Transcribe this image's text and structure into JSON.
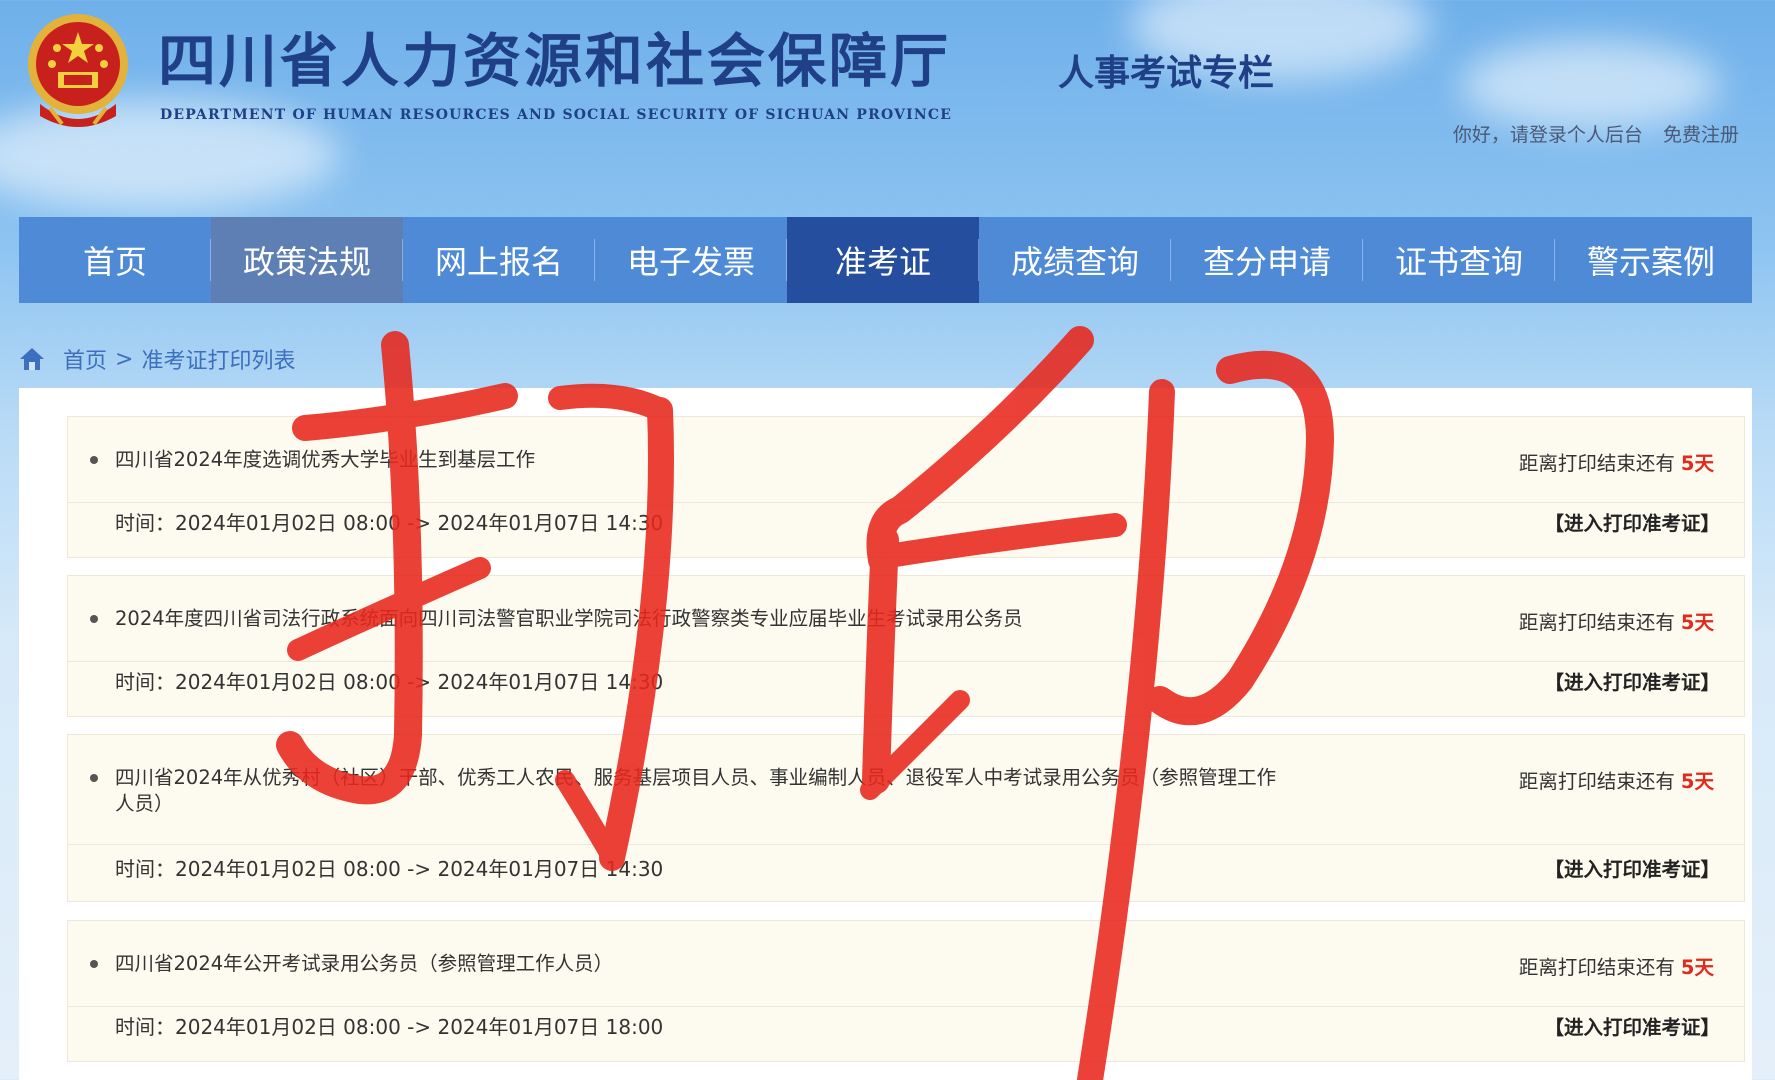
{
  "header": {
    "title": "四川省人力资源和社会保障厅",
    "subtitle": "DEPARTMENT OF HUMAN RESOURCES AND SOCIAL SECURITY OF SICHUAN PROVINCE",
    "column_title": "人事考试专栏",
    "login_text": "你好，请登录个人后台",
    "register_text": "免费注册"
  },
  "nav": {
    "items": [
      {
        "label": "首页"
      },
      {
        "label": "政策法规"
      },
      {
        "label": "网上报名"
      },
      {
        "label": "电子发票"
      },
      {
        "label": "准考证"
      },
      {
        "label": "成绩查询"
      },
      {
        "label": "查分申请"
      },
      {
        "label": "证书查询"
      },
      {
        "label": "警示案例"
      }
    ],
    "active_index": 4
  },
  "breadcrumb": {
    "home": "首页",
    "separator": ">",
    "current": "准考证打印列表"
  },
  "list": [
    {
      "title": "四川省2024年度选调优秀大学毕业生到基层工作",
      "countdown_label": "距离打印结束还有",
      "countdown_days": "5天",
      "time": "时间：2024年01月02日 08:00 -> 2024年01月07日 14:30",
      "action": "【进入打印准考证】"
    },
    {
      "title": "2024年度四川省司法行政系统面向四川司法警官职业学院司法行政警察类专业应届毕业生考试录用公务员",
      "countdown_label": "距离打印结束还有",
      "countdown_days": "5天",
      "time": "时间：2024年01月02日 08:00 -> 2024年01月07日 14:30",
      "action": "【进入打印准考证】"
    },
    {
      "title": "四川省2024年从优秀村（社区）干部、优秀工人农民、服务基层项目人员、事业编制人员、退役军人中考试录用公务员（参照管理工作人员）",
      "countdown_label": "距离打印结束还有",
      "countdown_days": "5天",
      "time": "时间：2024年01月02日 08:00 -> 2024年01月07日 14:30",
      "action": "【进入打印准考证】"
    },
    {
      "title": "四川省2024年公开考试录用公务员（参照管理工作人员）",
      "countdown_label": "距离打印结束还有",
      "countdown_days": "5天",
      "time": "时间：2024年01月02日 08:00 -> 2024年01月07日 18:00",
      "action": "【进入打印准考证】"
    }
  ],
  "annotation": {
    "text": "打印",
    "color": "#e8271c"
  },
  "colors": {
    "nav": "#4f8ad6",
    "nav_active": "#254f9e",
    "title": "#1f3f86",
    "countdown": "#e02a1e"
  }
}
